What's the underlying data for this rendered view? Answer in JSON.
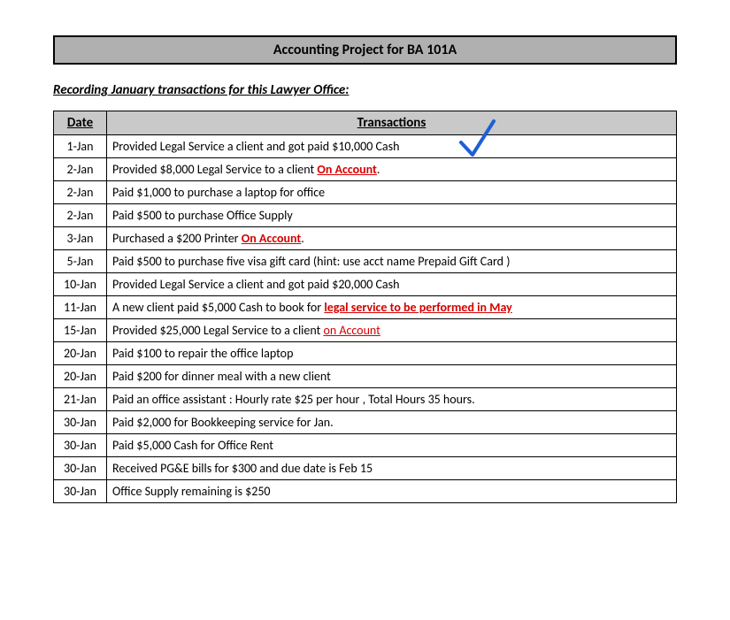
{
  "title": "Accounting Project for BA 101A",
  "subtitle": "Recording January  transactions for this Lawyer Office:",
  "table": {
    "headers": {
      "date": "Date",
      "transactions": "Transactions"
    },
    "rows": [
      {
        "date": "1-Jan",
        "segments": [
          {
            "text": "Provided Legal Service a client and got paid $10,000 Cash",
            "style": "plain"
          }
        ],
        "check": true
      },
      {
        "date": "2-Jan",
        "segments": [
          {
            "text": "Provided $8,000 Legal Service to a client ",
            "style": "plain"
          },
          {
            "text": "On Account",
            "style": "onacct"
          },
          {
            "text": ".",
            "style": "plain"
          }
        ]
      },
      {
        "date": "2-Jan",
        "segments": [
          {
            "text": "Paid $1,000 to purchase a laptop for office",
            "style": "plain"
          }
        ]
      },
      {
        "date": "2-Jan",
        "segments": [
          {
            "text": "Paid $500 to purchase Office Supply",
            "style": "plain"
          }
        ]
      },
      {
        "date": "3-Jan",
        "segments": [
          {
            "text": "Purchased a $200 Printer ",
            "style": "plain"
          },
          {
            "text": "On Account",
            "style": "onacct"
          },
          {
            "text": ".",
            "style": "plain"
          }
        ]
      },
      {
        "date": "5-Jan",
        "segments": [
          {
            "text": "Paid $500 to purchase five visa gift card (hint: use acct name Prepaid Gift Card )",
            "style": "plain"
          }
        ]
      },
      {
        "date": "10-Jan",
        "segments": [
          {
            "text": "Provided Legal Service a client and got paid $20,000 Cash",
            "style": "plain"
          }
        ]
      },
      {
        "date": "11-Jan",
        "segments": [
          {
            "text": "A new client paid $5,000 Cash to book for ",
            "style": "plain"
          },
          {
            "text": "legal service to be performed in May",
            "style": "onacct"
          }
        ]
      },
      {
        "date": "15-Jan",
        "segments": [
          {
            "text": "Provided $25,000 Legal Service to a client ",
            "style": "plain"
          },
          {
            "text": "on Account",
            "style": "redu"
          }
        ]
      },
      {
        "date": "20-Jan",
        "segments": [
          {
            "text": "Paid $100 to repair the  office laptop",
            "style": "plain"
          }
        ]
      },
      {
        "date": "20-Jan",
        "segments": [
          {
            "text": "Paid $200 for dinner meal with a new client",
            "style": "plain"
          }
        ]
      },
      {
        "date": "21-Jan",
        "segments": [
          {
            "text": "Paid an office assistant : Hourly rate $25 per hour ,  Total Hours 35 hours.",
            "style": "plain"
          }
        ]
      },
      {
        "date": "30-Jan",
        "segments": [
          {
            "text": "Paid $2,000 for Bookkeeping service for Jan.",
            "style": "plain"
          }
        ]
      },
      {
        "date": "30-Jan",
        "segments": [
          {
            "text": "Paid $5,000 Cash for Office Rent",
            "style": "plain"
          }
        ]
      },
      {
        "date": "30-Jan",
        "segments": [
          {
            "text": "Received PG&E bills for $300 and due date is Feb 15",
            "style": "plain"
          }
        ]
      },
      {
        "date": "30-Jan",
        "segments": [
          {
            "text": "Office Supply remaining is $250",
            "style": "plain"
          }
        ]
      }
    ]
  },
  "icons": {
    "checkmark": "checkmark"
  }
}
